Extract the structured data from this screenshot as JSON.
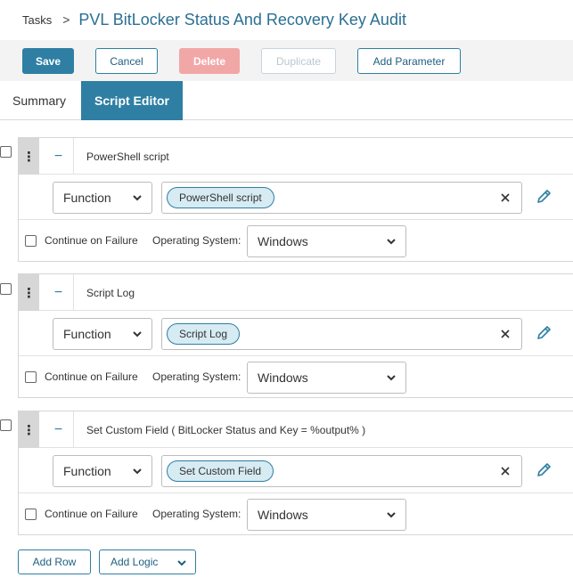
{
  "breadcrumb": {
    "root": "Tasks",
    "separator": ">",
    "title": "PVL BitLocker Status And Recovery Key Audit"
  },
  "toolbar": {
    "save": "Save",
    "cancel": "Cancel",
    "delete": "Delete",
    "duplicate": "Duplicate",
    "add_parameter": "Add Parameter"
  },
  "tabs": [
    {
      "label": "Summary",
      "active": false
    },
    {
      "label": "Script Editor",
      "active": true
    }
  ],
  "rows": [
    {
      "title": "PowerShell script",
      "function_select": "Function",
      "function_tag": "PowerShell script",
      "continue_label": "Continue on Failure",
      "continue_checked": false,
      "os_label": "Operating System:",
      "os_value": "Windows"
    },
    {
      "title": "Script Log",
      "function_select": "Function",
      "function_tag": "Script Log",
      "continue_label": "Continue on Failure",
      "continue_checked": false,
      "os_label": "Operating System:",
      "os_value": "Windows"
    },
    {
      "title": "Set Custom Field ( BitLocker Status and Key = %output% )",
      "function_select": "Function",
      "function_tag": "Set Custom Field",
      "continue_label": "Continue on Failure",
      "continue_checked": false,
      "os_label": "Operating System:",
      "os_value": "Windows"
    }
  ],
  "footer": {
    "add_row": "Add Row",
    "add_logic": "Add Logic"
  },
  "icons": {
    "drag": "vertical-dots-icon",
    "collapse": "minus-icon",
    "clear": "close-icon",
    "edit": "pencil-icon",
    "dropdown": "chevron-down-icon"
  },
  "colors": {
    "accent": "#2e7fa3",
    "title": "#2b6f92",
    "delete_disabled": "#f2a7a7",
    "tag_fill": "#d7ebf3"
  }
}
